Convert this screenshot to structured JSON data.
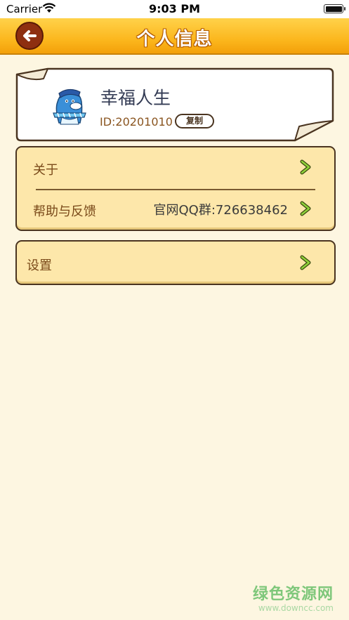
{
  "status_bar": {
    "carrier": "Carrier",
    "time": "9:03 PM"
  },
  "nav": {
    "title": "个人信息",
    "back_icon": "back-arrow-icon"
  },
  "profile": {
    "name": "幸福人生",
    "id_text": "ID:20201010",
    "copy_label": "复制",
    "avatar_icon": "penguin-avatar-icon"
  },
  "menu": {
    "about": {
      "label": "关于"
    },
    "help": {
      "label": "帮助与反馈",
      "value": "官网QQ群:726638462"
    },
    "settings": {
      "label": "设置"
    }
  },
  "watermark": {
    "cn": "绿色资源网",
    "url": "www.downcc.com"
  },
  "colors": {
    "nav_bar": "#fbb51b",
    "page_bg": "#fdf6e1",
    "menu_bg": "#fde7aa",
    "border": "#4a3420",
    "chevron": "#8fd23a"
  }
}
